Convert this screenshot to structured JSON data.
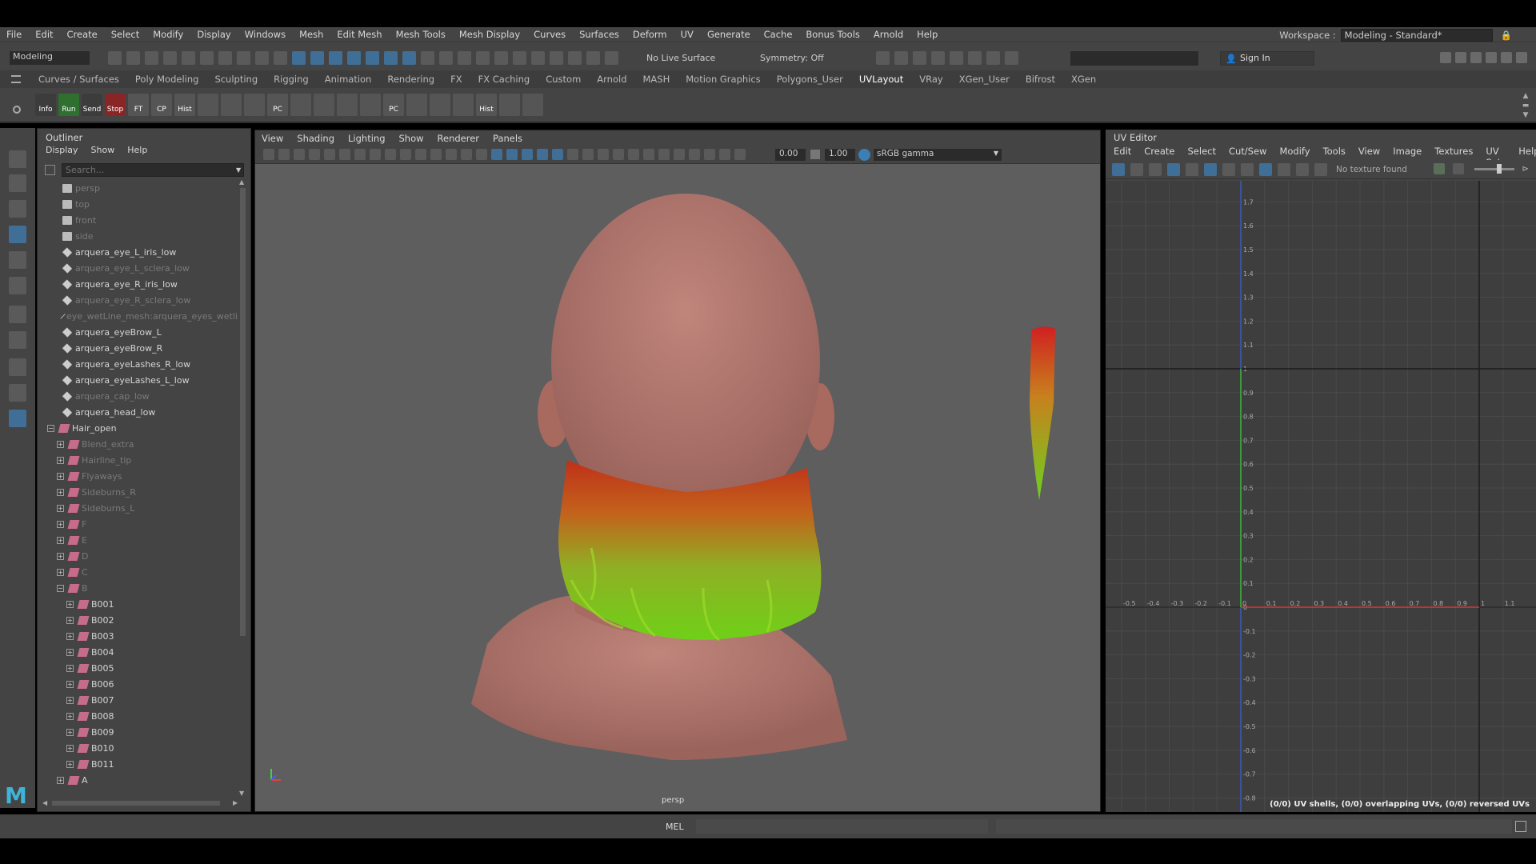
{
  "menu": [
    "File",
    "Edit",
    "Create",
    "Select",
    "Modify",
    "Display",
    "Windows",
    "Mesh",
    "Edit Mesh",
    "Mesh Tools",
    "Mesh Display",
    "Curves",
    "Surfaces",
    "Deform",
    "UV",
    "Generate",
    "Cache",
    "Bonus Tools",
    "Arnold",
    "Help"
  ],
  "workspace": {
    "label": "Workspace :",
    "value": "Modeling - Standard*"
  },
  "status": {
    "mode": "Modeling",
    "live_surface": "No Live Surface",
    "symmetry": "Symmetry: Off",
    "sign_in": "Sign In"
  },
  "shelf_tabs": [
    "Curves / Surfaces",
    "Poly Modeling",
    "Sculpting",
    "Rigging",
    "Animation",
    "Rendering",
    "FX",
    "FX Caching",
    "Custom",
    "Arnold",
    "MASH",
    "Motion Graphics",
    "Polygons_User",
    "UVLayout",
    "VRay",
    "XGen_User",
    "Bifrost",
    "XGen"
  ],
  "shelf_active": "UVLayout",
  "shelf_buttons": [
    {
      "label": "Info",
      "color": "#3c3c3c"
    },
    {
      "label": "Run",
      "color": "#2f6f2f"
    },
    {
      "label": "Send",
      "color": "#3c3c3c"
    },
    {
      "label": "Stop",
      "color": "#8a2525"
    },
    {
      "label": "FT",
      "color": "#555"
    },
    {
      "label": "CP",
      "color": "#555"
    },
    {
      "label": "Hist",
      "color": "#555"
    },
    {
      "label": "",
      "color": "#555"
    },
    {
      "label": "",
      "color": "#555"
    },
    {
      "label": "",
      "color": "#555"
    },
    {
      "label": "PC",
      "color": "#555"
    },
    {
      "label": "",
      "color": "#555"
    },
    {
      "label": "",
      "color": "#555"
    },
    {
      "label": "",
      "color": "#555"
    },
    {
      "label": "",
      "color": "#555"
    },
    {
      "label": "PC",
      "color": "#555"
    },
    {
      "label": "",
      "color": "#555"
    },
    {
      "label": "",
      "color": "#555"
    },
    {
      "label": "",
      "color": "#555"
    },
    {
      "label": "Hist",
      "color": "#555"
    },
    {
      "label": "",
      "color": "#555"
    },
    {
      "label": "",
      "color": "#555"
    }
  ],
  "outliner": {
    "title": "Outliner",
    "menu": [
      "Display",
      "Show",
      "Help"
    ],
    "search_placeholder": "Search...",
    "items": [
      {
        "label": "persp",
        "type": "camera",
        "dim": true,
        "indent": 0
      },
      {
        "label": "top",
        "type": "camera",
        "dim": true,
        "indent": 0
      },
      {
        "label": "front",
        "type": "camera",
        "dim": true,
        "indent": 0
      },
      {
        "label": "side",
        "type": "camera",
        "dim": true,
        "indent": 0
      },
      {
        "label": "arquera_eye_L_iris_low",
        "type": "mesh",
        "dim": false,
        "indent": 0
      },
      {
        "label": "arquera_eye_L_sclera_low",
        "type": "mesh",
        "dim": true,
        "indent": 0
      },
      {
        "label": "arquera_eye_R_iris_low",
        "type": "mesh",
        "dim": false,
        "indent": 0
      },
      {
        "label": "arquera_eye_R_sclera_low",
        "type": "mesh",
        "dim": true,
        "indent": 0
      },
      {
        "label": "eye_wetLine_mesh:arquera_eyes_wetli",
        "type": "mesh",
        "dim": true,
        "indent": 0
      },
      {
        "label": "arquera_eyeBrow_L",
        "type": "mesh",
        "dim": false,
        "indent": 0
      },
      {
        "label": "arquera_eyeBrow_R",
        "type": "mesh",
        "dim": false,
        "indent": 0
      },
      {
        "label": "arquera_eyeLashes_R_low",
        "type": "mesh",
        "dim": false,
        "indent": 0
      },
      {
        "label": "arquera_eyeLashes_L_low",
        "type": "mesh",
        "dim": false,
        "indent": 0
      },
      {
        "label": "arquera_cap_low",
        "type": "mesh",
        "dim": true,
        "indent": 0
      },
      {
        "label": "arquera_head_low",
        "type": "mesh",
        "dim": false,
        "indent": 0
      },
      {
        "label": "Hair_open",
        "type": "xgen",
        "dim": false,
        "indent": 0,
        "exp": "−"
      },
      {
        "label": "Blend_extra",
        "type": "xgen",
        "dim": true,
        "indent": 1,
        "exp": "+"
      },
      {
        "label": "Hairline_tip",
        "type": "xgen",
        "dim": true,
        "indent": 1,
        "exp": "+"
      },
      {
        "label": "Flyaways",
        "type": "xgen",
        "dim": true,
        "indent": 1,
        "exp": "+"
      },
      {
        "label": "Sideburns_R",
        "type": "xgen",
        "dim": true,
        "indent": 1,
        "exp": "+"
      },
      {
        "label": "Sideburns_L",
        "type": "xgen",
        "dim": true,
        "indent": 1,
        "exp": "+"
      },
      {
        "label": "F",
        "type": "xgen",
        "dim": true,
        "indent": 1,
        "exp": "+"
      },
      {
        "label": "E",
        "type": "xgen",
        "dim": true,
        "indent": 1,
        "exp": "+"
      },
      {
        "label": "D",
        "type": "xgen",
        "dim": true,
        "indent": 1,
        "exp": "+"
      },
      {
        "label": "C",
        "type": "xgen",
        "dim": true,
        "indent": 1,
        "exp": "+"
      },
      {
        "label": "B",
        "type": "xgen",
        "dim": true,
        "indent": 1,
        "exp": "−"
      },
      {
        "label": "B001",
        "type": "xgen",
        "dim": false,
        "indent": 2,
        "exp": "+"
      },
      {
        "label": "B002",
        "type": "xgen",
        "dim": false,
        "indent": 2,
        "exp": "+"
      },
      {
        "label": "B003",
        "type": "xgen",
        "dim": false,
        "indent": 2,
        "exp": "+"
      },
      {
        "label": "B004",
        "type": "xgen",
        "dim": false,
        "indent": 2,
        "exp": "+"
      },
      {
        "label": "B005",
        "type": "xgen",
        "dim": false,
        "indent": 2,
        "exp": "+"
      },
      {
        "label": "B006",
        "type": "xgen",
        "dim": false,
        "indent": 2,
        "exp": "+"
      },
      {
        "label": "B007",
        "type": "xgen",
        "dim": false,
        "indent": 2,
        "exp": "+"
      },
      {
        "label": "B008",
        "type": "xgen",
        "dim": false,
        "indent": 2,
        "exp": "+"
      },
      {
        "label": "B009",
        "type": "xgen",
        "dim": false,
        "indent": 2,
        "exp": "+"
      },
      {
        "label": "B010",
        "type": "xgen",
        "dim": false,
        "indent": 2,
        "exp": "+"
      },
      {
        "label": "B011",
        "type": "xgen",
        "dim": false,
        "indent": 2,
        "exp": "+"
      },
      {
        "label": "A",
        "type": "xgen",
        "dim": false,
        "indent": 1,
        "exp": "+"
      }
    ]
  },
  "viewport": {
    "menu": [
      "View",
      "Shading",
      "Lighting",
      "Show",
      "Renderer",
      "Panels"
    ],
    "exposure": "0.00",
    "gamma": "1.00",
    "color_space": "sRGB gamma",
    "camera": "persp"
  },
  "uv_editor": {
    "title": "UV Editor",
    "menu": [
      "Edit",
      "Create",
      "Select",
      "Cut/Sew",
      "Modify",
      "Tools",
      "View",
      "Image",
      "Textures",
      "UV Sets",
      "Help"
    ],
    "texture_status": "No texture found",
    "x_ticks": [
      "-0.5",
      "-0.4",
      "-0.3",
      "-0.2",
      "-0.1",
      "0",
      "0.1",
      "0.2",
      "0.3",
      "0.4",
      "0.5",
      "0.6",
      "0.7",
      "0.8",
      "0.9",
      "1",
      "1.1"
    ],
    "y_ticks": [
      "1.7",
      "1.6",
      "1.5",
      "1.4",
      "1.3",
      "1.2",
      "1.1",
      "1",
      "0.9",
      "0.8",
      "0.7",
      "0.6",
      "0.5",
      "0.4",
      "0.3",
      "0.2",
      "0.1",
      "0",
      "-0.1",
      "-0.2",
      "-0.3",
      "-0.4",
      "-0.5",
      "-0.6",
      "-0.7",
      "-0.8"
    ],
    "stats": "(0/0) UV shells, (0/0) overlapping UVs, (0/0) reversed UVs"
  },
  "command_line": {
    "lang": "MEL"
  },
  "colors": {
    "panel": "#444444",
    "viewport": "#5e5e5e",
    "accent": "#5aa0d8",
    "skin": "#b77b73"
  }
}
